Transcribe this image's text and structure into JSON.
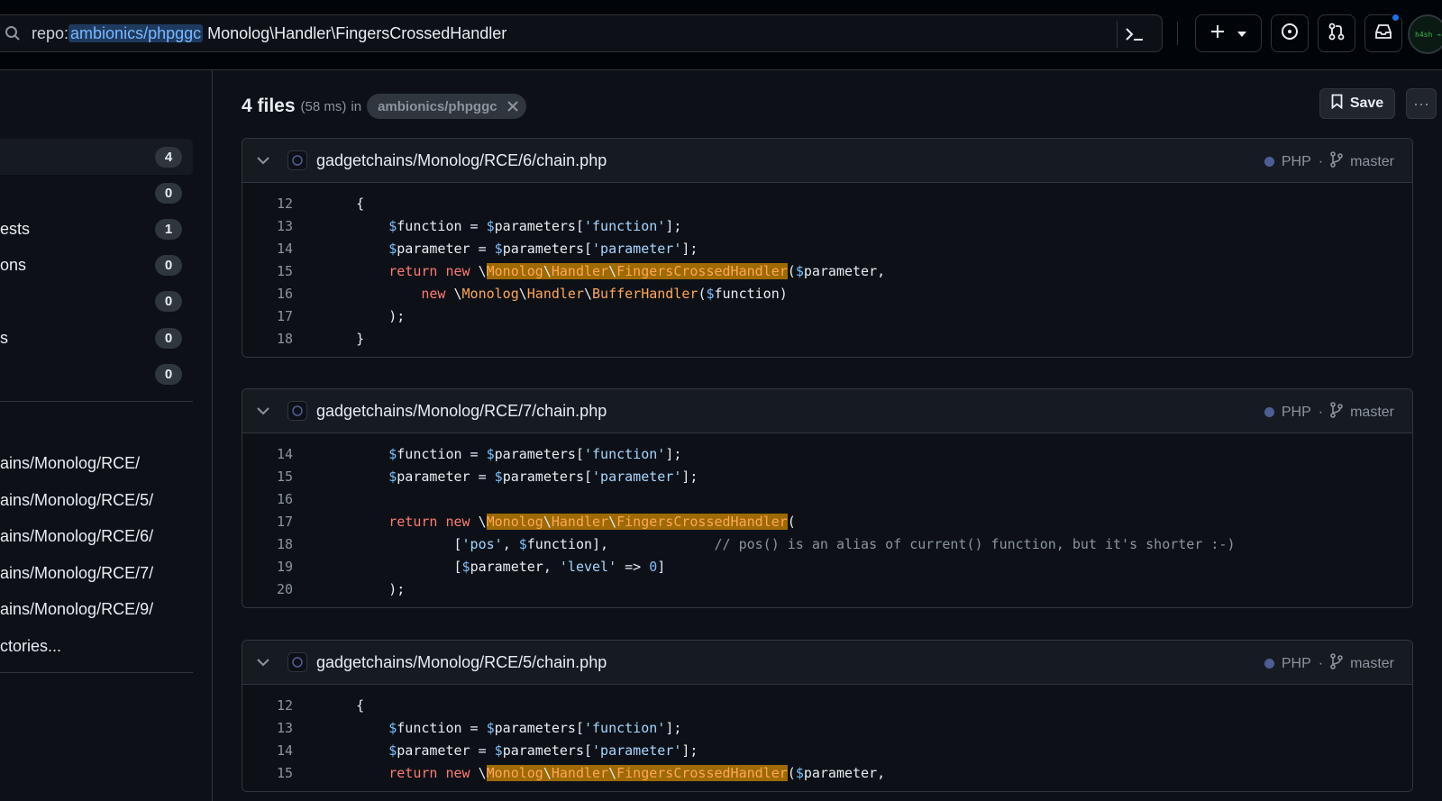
{
  "topbar": {
    "search_prefix": "repo:",
    "search_repo": "ambionics/phpggc",
    "search_term": " Monolog\\Handler\\FingersCrossedHandler",
    "avatar_text": "h4sh →"
  },
  "sidebar": {
    "counts": [
      {
        "label": "",
        "count": "4"
      },
      {
        "label": "",
        "count": "0"
      },
      {
        "label": "ests",
        "count": "1"
      },
      {
        "label": "ons",
        "count": "0"
      },
      {
        "label": "",
        "count": "0"
      },
      {
        "label": "s",
        "count": "0"
      },
      {
        "label": "",
        "count": "0"
      }
    ],
    "paths": [
      "ains/Monolog/RCE/",
      "ains/Monolog/RCE/5/",
      "ains/Monolog/RCE/6/",
      "ains/Monolog/RCE/7/",
      "ains/Monolog/RCE/9/",
      "ctories..."
    ]
  },
  "results": {
    "count": "4 files",
    "time": "(58 ms)",
    "in": "in",
    "repo_chip": "ambionics/phpggc",
    "save": "Save",
    "more": "···"
  },
  "files": [
    {
      "path": "gadgetchains/Monolog/RCE/6/chain.php",
      "lang": "PHP",
      "branch": "master",
      "lang_color": "#4F5D95"
    },
    {
      "path": "gadgetchains/Monolog/RCE/7/chain.php",
      "lang": "PHP",
      "branch": "master",
      "lang_color": "#4F5D95"
    },
    {
      "path": "gadgetchains/Monolog/RCE/5/chain.php",
      "lang": "PHP",
      "branch": "master",
      "lang_color": "#4F5D95"
    }
  ],
  "code_lines": {
    "f1": [
      "12",
      "13",
      "14",
      "15",
      "16",
      "17",
      "18"
    ],
    "f2": [
      "14",
      "15",
      "16",
      "17",
      "18",
      "19",
      "20"
    ],
    "f3": [
      "12",
      "13",
      "14",
      "15"
    ]
  },
  "code_text": {
    "open_brace": "{",
    "close_brace": "}",
    "close_paren": ");",
    "function_var": "$function",
    "parameter_var": "$parameter",
    "parameters_var": "$parameters",
    "function_str": "'function'",
    "parameter_str": "'parameter'",
    "return": "return",
    "new": "new",
    "monolog": "Monolog",
    "handler": "Handler",
    "fch": "FingersCrossedHandler",
    "buffer": "BufferHandler",
    "pos_str": "'pos'",
    "level_str": "'level'",
    "zero": "0",
    "comment": "// pos() is an alias of current() function, but it's shorter :-)"
  }
}
